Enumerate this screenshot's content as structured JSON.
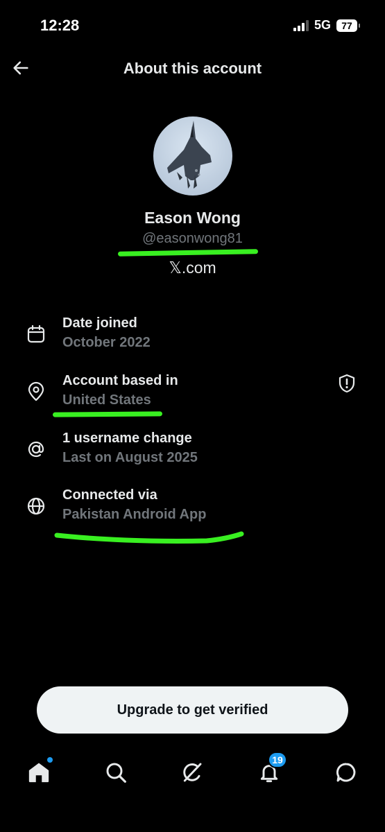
{
  "status": {
    "time": "12:28",
    "network": "5G",
    "battery": "77"
  },
  "header": {
    "title": "About this account"
  },
  "profile": {
    "name": "Eason Wong",
    "handle": "@easonwong81",
    "site": "𝕏.com"
  },
  "info": [
    {
      "icon": "calendar-icon",
      "label": "Date joined",
      "value": "October 2022"
    },
    {
      "icon": "location-pin-icon",
      "label": "Account based in",
      "value": "United States"
    },
    {
      "icon": "at-sign-icon",
      "label": "1 username change",
      "value": "Last on August 2025"
    },
    {
      "icon": "globe-icon",
      "label": "Connected via",
      "value": "Pakistan Android App"
    }
  ],
  "upgrade_button": {
    "label": "Upgrade to get verified"
  },
  "tabs": [
    {
      "icon": "home-icon",
      "active": true
    },
    {
      "icon": "search-icon"
    },
    {
      "icon": "grok-icon"
    },
    {
      "icon": "bell-icon",
      "badge": "19"
    },
    {
      "icon": "chat-bubble-icon"
    }
  ],
  "colors": {
    "background": "#000000",
    "text": "#e7e9ea",
    "secondary_text": "#71767b",
    "accent": "#1d9bf0",
    "highlight": "#39f021",
    "button_bg": "#eff3f4"
  }
}
